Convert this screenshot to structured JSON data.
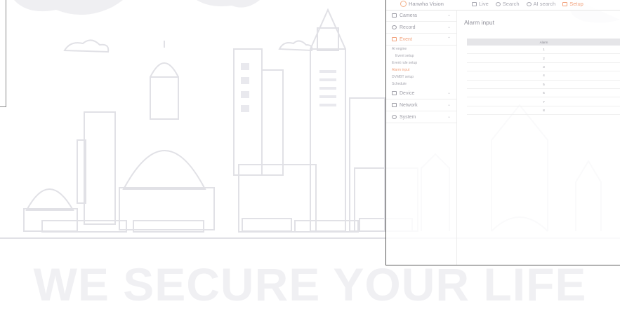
{
  "nvr": {
    "brand": "Hanwha Vision",
    "top_nav": [
      {
        "label": "Live",
        "icon": "monitor-icon"
      },
      {
        "label": "Search",
        "icon": "search-icon"
      },
      {
        "label": "AI search",
        "icon": "ai-search-icon"
      },
      {
        "label": "Setup",
        "icon": "setup-icon",
        "active": true
      }
    ],
    "menus": {
      "camera": "Camera",
      "record": "Record",
      "event": "Event",
      "device": "Device",
      "network": "Network",
      "system": "System"
    },
    "event_submenu": [
      "AI engine",
      "Event setup",
      "Event rule setup",
      "Alarm input",
      "DVMBT setup",
      "Schedule"
    ],
    "active_submenu": "Alarm input",
    "page_title": "Alarm input",
    "table": {
      "header": "Alarm",
      "rows": [
        "1",
        "2",
        "3",
        "4",
        "5",
        "6",
        "7",
        "8"
      ]
    }
  },
  "background": {
    "tagline": "WE SECURE YOUR LIFE"
  },
  "colors": {
    "accent": "#f2a27c",
    "line_art": "#e1e1e6",
    "tagline": "#f0f0f3"
  }
}
